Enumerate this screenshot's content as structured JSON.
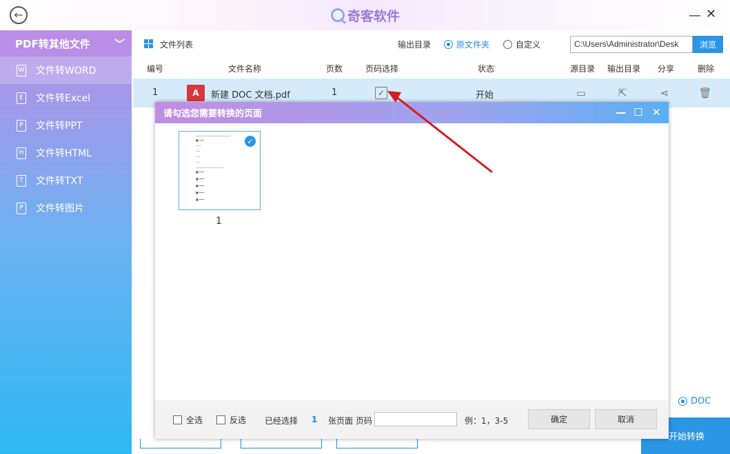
{
  "titlebar": {
    "back_icon": "←",
    "app_name": "奇客软件",
    "minimize": "—",
    "close": "✕"
  },
  "sidebar": {
    "header": "PDF转其他文件",
    "items": [
      {
        "label": "文件转WORD",
        "icon": "W"
      },
      {
        "label": "文件转Excel",
        "icon": "E"
      },
      {
        "label": "文件转PPT",
        "icon": "P"
      },
      {
        "label": "文件转HTML",
        "icon": "H"
      },
      {
        "label": "文件转TXT",
        "icon": "T"
      },
      {
        "label": "文件转图片",
        "icon": "P"
      }
    ]
  },
  "toolbar": {
    "file_list": "文件列表",
    "output_dir": "输出目录",
    "opt_source": "原文件夹",
    "opt_custom": "自定义",
    "path": "C:\\Users\\Administrator\\Desk",
    "browse": "浏览"
  },
  "table": {
    "headers": [
      "编号",
      "文件名称",
      "页数",
      "页码选择",
      "状态",
      "源目录",
      "输出目录",
      "分享",
      "删除"
    ],
    "rows": [
      {
        "index": "1",
        "name": "新建 DOC 文档.pdf",
        "pages": "1",
        "status": "开始"
      }
    ]
  },
  "dialog": {
    "title": "请勾选您需要转换的页面",
    "page_label": "1",
    "select_all": "全选",
    "invert": "反选",
    "selected_prefix": "已经选择",
    "selected_count": "1",
    "selected_suffix": "张页面 页码",
    "example": "例：1，3-5",
    "ok": "确定",
    "cancel": "取消"
  },
  "background": {
    "format": "DOC",
    "start": "开始转换"
  },
  "colors": {
    "accent": "#2b95e6",
    "arrow": "#d11f1f"
  }
}
